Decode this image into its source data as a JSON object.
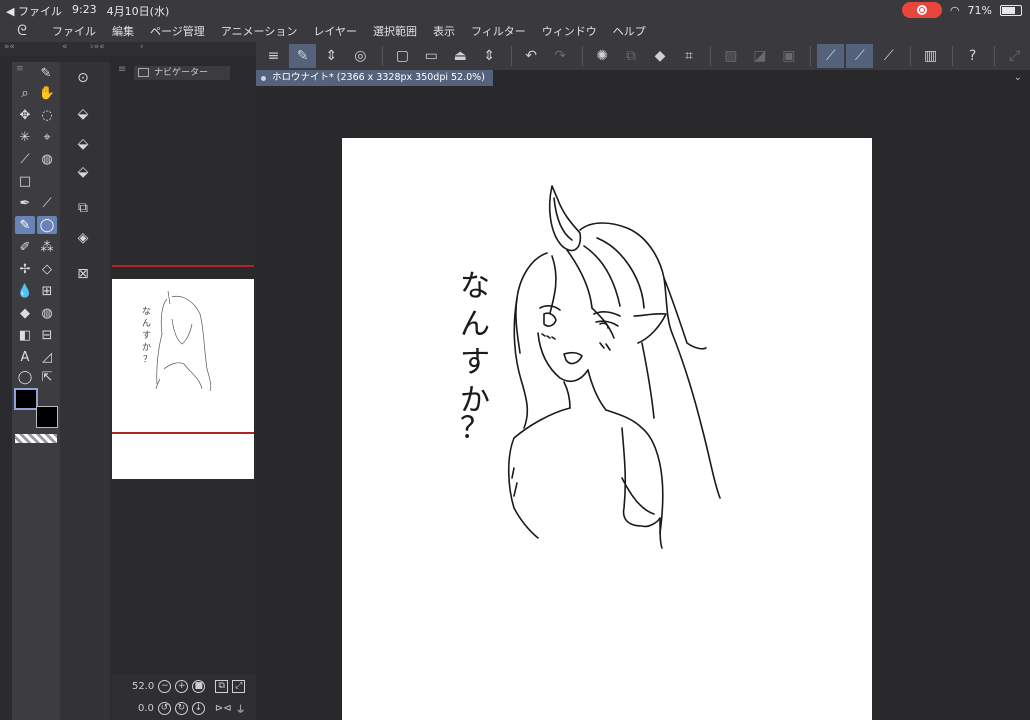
{
  "status_bar": {
    "back_label": "◀ ファイル",
    "time": "9:23",
    "date": "4月10日(水)",
    "battery_percent": "71%",
    "battery_level": 0.71
  },
  "menu": {
    "items": [
      "ファイル",
      "編集",
      "ページ管理",
      "アニメーション",
      "レイヤー",
      "選択範囲",
      "表示",
      "フィルター",
      "ウィンドウ",
      "ヘルプ"
    ]
  },
  "navigator": {
    "tab_label": "ナビゲーター",
    "zoom_value": "52.0",
    "rotation_value": "0.0"
  },
  "document": {
    "tab_title": "ホロウナイト* (2366 x 3328px 350dpi 52.0%)",
    "drawn_text": "なんすか？"
  },
  "colors": {
    "accent": "#55627c",
    "selected_tool": "#6a83b6",
    "record_red": "#e8453c",
    "foreground_color": "#000000",
    "background_color": "#000000",
    "navigator_frame": "#b12424"
  }
}
